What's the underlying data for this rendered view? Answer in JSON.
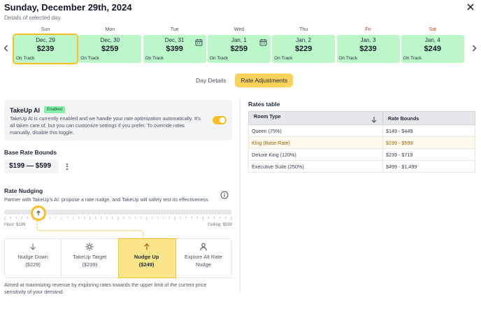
{
  "header": {
    "title": "Sunday, December 29th, 2024",
    "subtitle": "Details of selected day."
  },
  "days": [
    {
      "dow": "Sun",
      "date": "Dec, 29",
      "price": "$239",
      "status": "On Track",
      "weekend": false,
      "selected": true,
      "calendar_icon": false
    },
    {
      "dow": "Mon",
      "date": "Dec, 30",
      "price": "$259",
      "status": "On Track",
      "weekend": false,
      "selected": false,
      "calendar_icon": false
    },
    {
      "dow": "Tue",
      "date": "Dec, 31",
      "price": "$399",
      "status": "On Track",
      "weekend": false,
      "selected": false,
      "calendar_icon": true
    },
    {
      "dow": "Wed",
      "date": "Jan, 1",
      "price": "$259",
      "status": "On Track",
      "weekend": false,
      "selected": false,
      "calendar_icon": true
    },
    {
      "dow": "Thu",
      "date": "Jan, 2",
      "price": "$229",
      "status": "On Track",
      "weekend": false,
      "selected": false,
      "calendar_icon": false
    },
    {
      "dow": "Fri",
      "date": "Jan, 3",
      "price": "$239",
      "status": "On Track",
      "weekend": true,
      "selected": false,
      "calendar_icon": false
    },
    {
      "dow": "Sat",
      "date": "Jan, 4",
      "price": "$249",
      "status": "On Track",
      "weekend": true,
      "selected": false,
      "calendar_icon": false
    }
  ],
  "tabs": [
    {
      "label": "Day Details",
      "active": false
    },
    {
      "label": "Rate Adjustments",
      "active": true
    }
  ],
  "takeup": {
    "title": "TakeUp AI",
    "badge": "Enabled",
    "description": "TakeUp AI is currently enabled and we handle your rate optimization automatically. It's all taken care of, but you can customize settings if you prefer. To override rates manually, disable this toggle.",
    "toggle_on": true
  },
  "base_rate": {
    "label": "Base Rate Bounds",
    "value": "$199 — $599"
  },
  "nudging": {
    "label": "Rate Nudging",
    "description": "Partner with TakeUp's AI: propose a rate nudge, and TakeUp will safely test its effectiveness",
    "floor": "Floor: $199",
    "ceiling": "Ceiling: $599",
    "options": [
      {
        "icon": "arrow-down-icon",
        "label": "Nudge Down",
        "sub": "($229)",
        "selected": false
      },
      {
        "icon": "target-icon",
        "label": "TakeUp Target",
        "sub": "($239)",
        "selected": false
      },
      {
        "icon": "arrow-up-icon",
        "label": "Nudge Up",
        "sub": "($249)",
        "selected": true
      },
      {
        "icon": "person-icon",
        "label": "Explore Alt Rate",
        "sub": "Nudge",
        "selected": false
      }
    ],
    "footer": "Aimed at maximizing revenue by exploring rates towards the upper limit of the current price sensitivity of your demand."
  },
  "rates": {
    "title": "Rates table",
    "headers": [
      "Room Type",
      "Rate Bounds"
    ],
    "rows": [
      {
        "room": "Queen (75%)",
        "bounds": "$149 - $449",
        "base": false
      },
      {
        "room": "King (Base Rate)",
        "bounds": "$199 - $599",
        "base": true
      },
      {
        "room": "Deluxe King (120%)",
        "bounds": "$239 - $719",
        "base": false
      },
      {
        "room": "Executive Suite (250%)",
        "bounds": "$499 - $1,499",
        "base": false
      }
    ]
  },
  "colors": {
    "accent": "#fbbf24",
    "card_green": "#bbf7c8",
    "weekend": "#c2410c",
    "base_rate_text": "#a16207"
  }
}
